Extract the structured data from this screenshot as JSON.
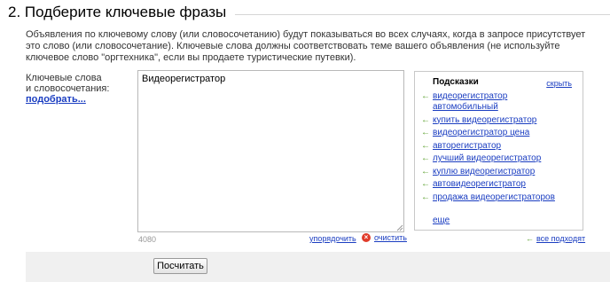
{
  "section": {
    "title": "2. Подберите ключевые фразы",
    "description": "Объявления по ключевому слову (или словосочетанию) будут показываться во всех случаях, когда в запросе присутствует это слово (или словосочетание). Ключевые слова должны соответствовать теме вашего объявления (не используйте ключевое слово \"оргтехника\", если вы продаете туристические путевки)."
  },
  "keywords": {
    "label_line1": "Ключевые слова",
    "label_line2": "и словосочетания:",
    "pick_link": "подобрать...",
    "value": "Видеорегистратор",
    "counter": "4080",
    "order_link": "упорядочить",
    "clear_link": "очистить"
  },
  "hints": {
    "title": "Подсказки",
    "hide_link": "скрыть",
    "items": [
      "видеорегистратор автомобильный",
      "купить видеорегистратор",
      "видеорегистратор цена",
      "авторегистратор",
      "лучший видеорегистратор",
      "куплю видеорегистратор",
      "автовидеорегистратор",
      "продажа видеорегистраторов"
    ],
    "more_link": "еще",
    "all_fit_link": "все подходят",
    "arrow_glyph": "←"
  },
  "actions": {
    "calculate_button": "Посчитать"
  },
  "colors": {
    "link": "#1a3dc1",
    "arrow": "#5aa02c",
    "clear_icon": "#e03b2a",
    "footer_band": "#f0f0f0"
  },
  "icons": {
    "hint_arrow": "green-arrow-left-icon",
    "clear": "red-x-circle-icon",
    "resize": "textarea-resize-grip-icon"
  }
}
